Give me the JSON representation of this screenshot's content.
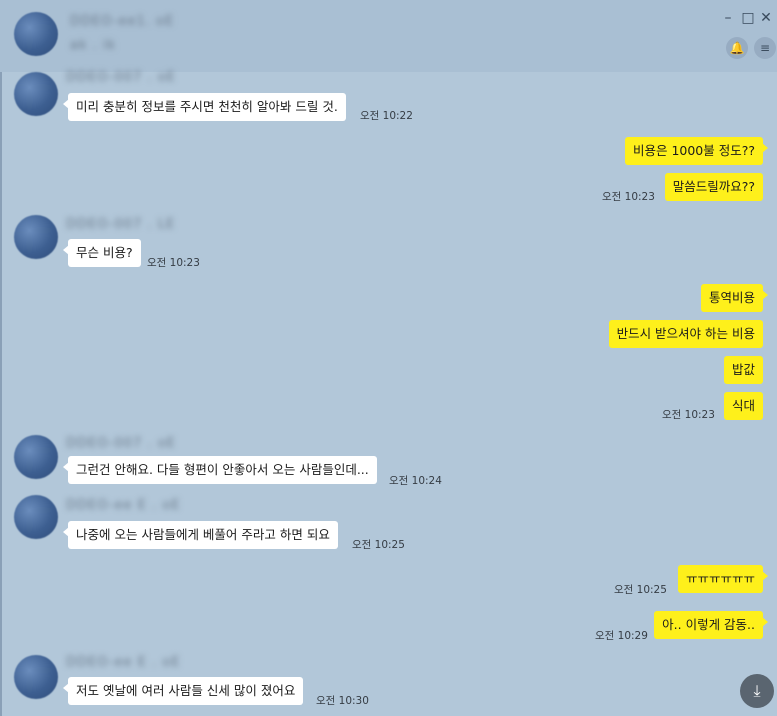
{
  "header": {
    "name": "DDEO-ee1. oE",
    "status": "ak . ik",
    "minimize_icon": "minimize-icon",
    "maximize_icon": "maximize-icon",
    "bell_icon": "bell-icon",
    "menu_icon": "menu-icon"
  },
  "messages": [
    {
      "sender": "DDEO-007 . oE",
      "text": "미리 충분히 정보를 주시면 천천히 알아봐 드릴 것.",
      "time": "오전 10:22"
    },
    {
      "text": "비용은 1000불 정도??"
    },
    {
      "text": "말씀드릴까요??",
      "time": "오전 10:23"
    },
    {
      "sender": "DDEO-007 . LE",
      "text": "무슨 비용?",
      "time": "오전 10:23"
    },
    {
      "text": "통역비용"
    },
    {
      "text": "반드시 받으셔야 하는 비용"
    },
    {
      "text": "밥값"
    },
    {
      "text": "식대",
      "time": "오전 10:23"
    },
    {
      "sender": "DDEO-007 . oE",
      "text": "그런건 안해요. 다들 형편이 안좋아서 오는 사람들인데...",
      "time": "오전 10:24"
    },
    {
      "sender": "DDEO-ee E . oE",
      "text": "나중에 오는 사람들에게 베풀어 주라고 하면 되요",
      "time": "오전 10:25"
    },
    {
      "text": "ㅠㅠㅠㅠㅠㅠ",
      "time": "오전 10:25"
    },
    {
      "text": "아.. 이렇게 감동..",
      "time": "오전 10:29"
    },
    {
      "sender": "DDEO-ee E . oE",
      "text": "저도 옛날에 여러 사람들 신세 많이 졌어요",
      "time": "오전 10:30"
    }
  ],
  "scroll_down_icon": "scroll-down-icon"
}
